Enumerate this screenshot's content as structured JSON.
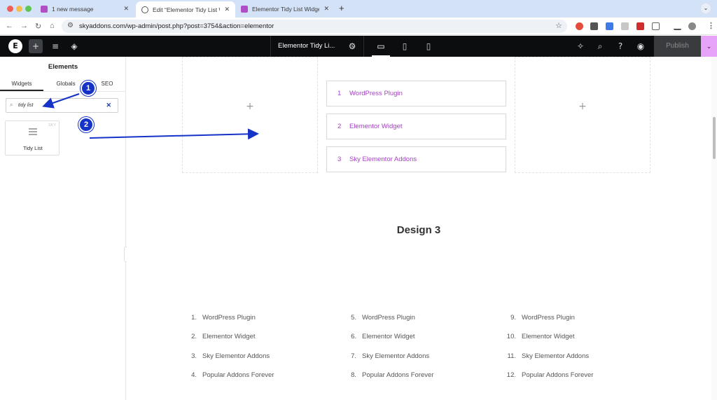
{
  "browser": {
    "tabs": [
      {
        "label": "1 new message",
        "favicon_color": "#b04fc5"
      },
      {
        "label": "Edit “Elementor Tidy List Wid",
        "favicon_color": "#555555"
      },
      {
        "label": "Elementor Tidy List Widget -",
        "favicon_color": "#b04fc5"
      }
    ],
    "new_tab": "+",
    "url": "skyaddons.com/wp-admin/post.php?post=3754&action=elementor"
  },
  "editor": {
    "page_title": "Elementor Tidy Li...",
    "publish_label": "Publish",
    "accent_color": "#e6a3f7"
  },
  "panel": {
    "title": "Elements",
    "tabs": [
      "Widgets",
      "Globals",
      "SEO"
    ],
    "search_value": "tidy list",
    "widget": {
      "label": "Tidy List",
      "badge": "SKY"
    }
  },
  "canvas": {
    "design2_items": [
      {
        "num": "1",
        "text": "WordPress Plugin"
      },
      {
        "num": "2",
        "text": "Elementor Widget"
      },
      {
        "num": "3",
        "text": "Sky Elementor Addons"
      }
    ],
    "design3_title": "Design 3",
    "design3_columns": [
      [
        {
          "num": "1.",
          "text": "WordPress Plugin"
        },
        {
          "num": "2.",
          "text": "Elementor Widget"
        },
        {
          "num": "3.",
          "text": "Sky Elementor Addons"
        },
        {
          "num": "4.",
          "text": "Popular Addons Forever"
        }
      ],
      [
        {
          "num": "5.",
          "text": "WordPress Plugin"
        },
        {
          "num": "6.",
          "text": "Elementor Widget"
        },
        {
          "num": "7.",
          "text": "Sky Elementor Addons"
        },
        {
          "num": "8.",
          "text": "Popular Addons Forever"
        }
      ],
      [
        {
          "num": "9.",
          "text": "WordPress Plugin"
        },
        {
          "num": "10.",
          "text": "Elementor Widget"
        },
        {
          "num": "11.",
          "text": "Sky Elementor Addons"
        },
        {
          "num": "12.",
          "text": "Popular Addons Forever"
        }
      ]
    ],
    "list_color": "#a344c2"
  },
  "annotations": {
    "step1": "1",
    "step2": "2",
    "color": "#1533c7"
  }
}
